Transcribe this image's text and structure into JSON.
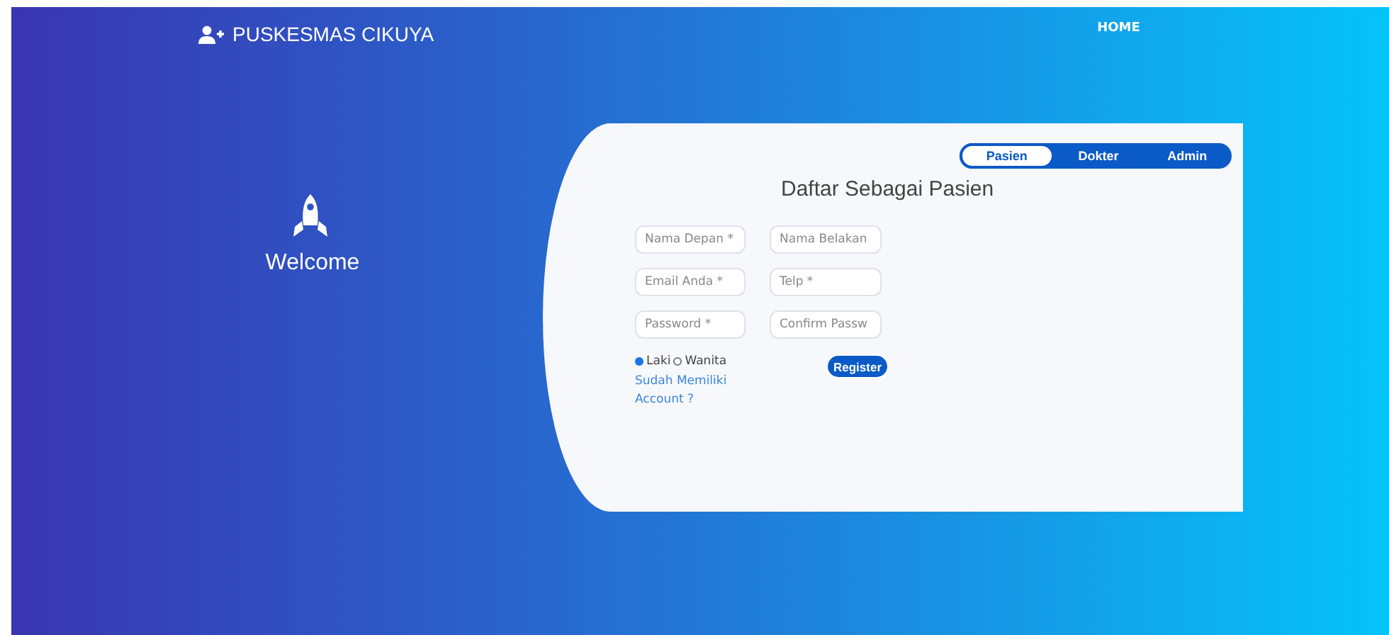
{
  "navbar": {
    "brand": "PUSKESMAS CIKUYA",
    "links": [
      "HOME"
    ]
  },
  "welcome": {
    "title": "Welcome"
  },
  "register_card": {
    "tabs": [
      {
        "label": "Pasien",
        "selected": true
      },
      {
        "label": "Dokter",
        "selected": false
      },
      {
        "label": "Admin",
        "selected": false
      }
    ],
    "title": "Daftar Sebagai Pasien",
    "fields": [
      {
        "placeholder": "Nama Depan *"
      },
      {
        "placeholder": "Nama Belakan"
      },
      {
        "placeholder": "Email Anda *"
      },
      {
        "placeholder": "Telp *"
      },
      {
        "placeholder": "Password *"
      },
      {
        "placeholder": "Confirm Passw"
      }
    ],
    "gender": [
      {
        "label": "Laki",
        "selected": true
      },
      {
        "label": "Wanita",
        "selected": false
      }
    ],
    "login_link": "Sudah Memiliki Account ?",
    "register_button": "Register"
  }
}
